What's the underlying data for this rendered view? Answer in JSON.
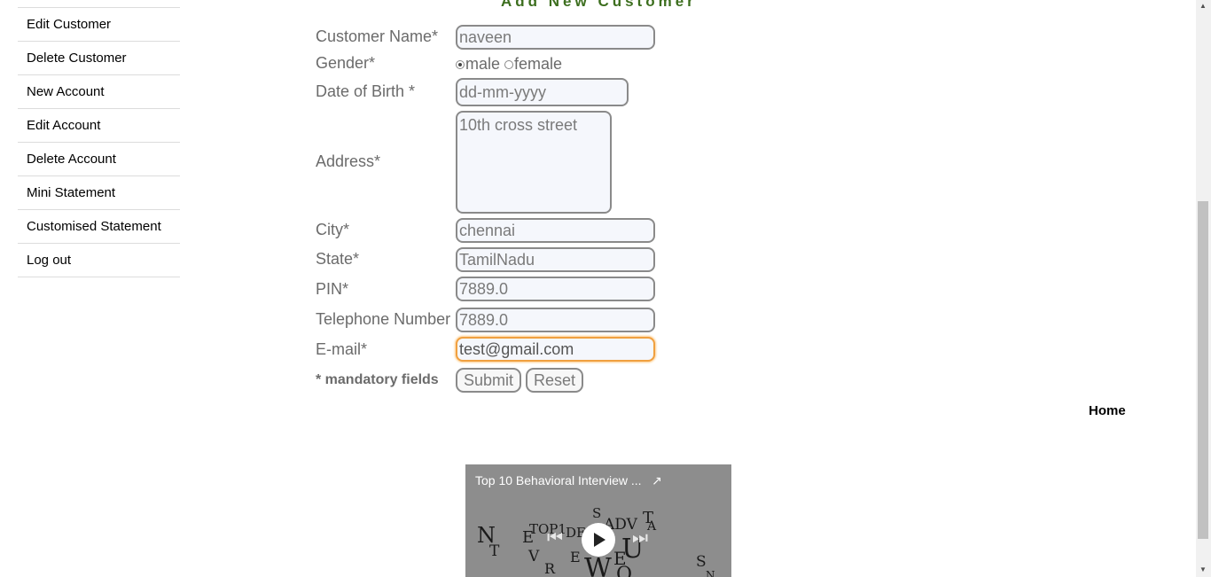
{
  "sidebar": {
    "items": [
      {
        "label": "Edit Customer"
      },
      {
        "label": "Delete Customer"
      },
      {
        "label": "New Account"
      },
      {
        "label": "Edit Account"
      },
      {
        "label": "Delete Account"
      },
      {
        "label": "Mini Statement"
      },
      {
        "label": "Customised Statement"
      },
      {
        "label": "Log out"
      }
    ]
  },
  "form": {
    "title": "Add New Customer",
    "customer_name": {
      "label": "Customer Name*",
      "value": "naveen"
    },
    "gender": {
      "label": "Gender*",
      "options": [
        "male",
        "female"
      ],
      "selected": "male"
    },
    "dob": {
      "label": "Date of Birth *",
      "placeholder": "dd-mm-yyyy"
    },
    "address": {
      "label": "Address*",
      "value": "10th cross street"
    },
    "city": {
      "label": "City*",
      "value": "chennai"
    },
    "state": {
      "label": "State*",
      "value": "TamilNadu"
    },
    "pin": {
      "label": "PIN*",
      "value": "7889.0"
    },
    "telephone": {
      "label": "Telephone Number",
      "value": "7889.0"
    },
    "email": {
      "label": "E-mail*",
      "value": "test@gmail.com"
    },
    "mandatory_note": "* mandatory fields",
    "submit_label": "Submit",
    "reset_label": "Reset"
  },
  "home_link": "Home",
  "video": {
    "title": "Top 10 Behavioral Interview ...",
    "share_icon": "share-icon",
    "play_icon": "play-icon",
    "prev_icon": "skip-previous-icon",
    "next_icon": "skip-next-icon"
  },
  "colors": {
    "title_green": "#3c6e1e",
    "focus_orange": "#f0a040"
  }
}
